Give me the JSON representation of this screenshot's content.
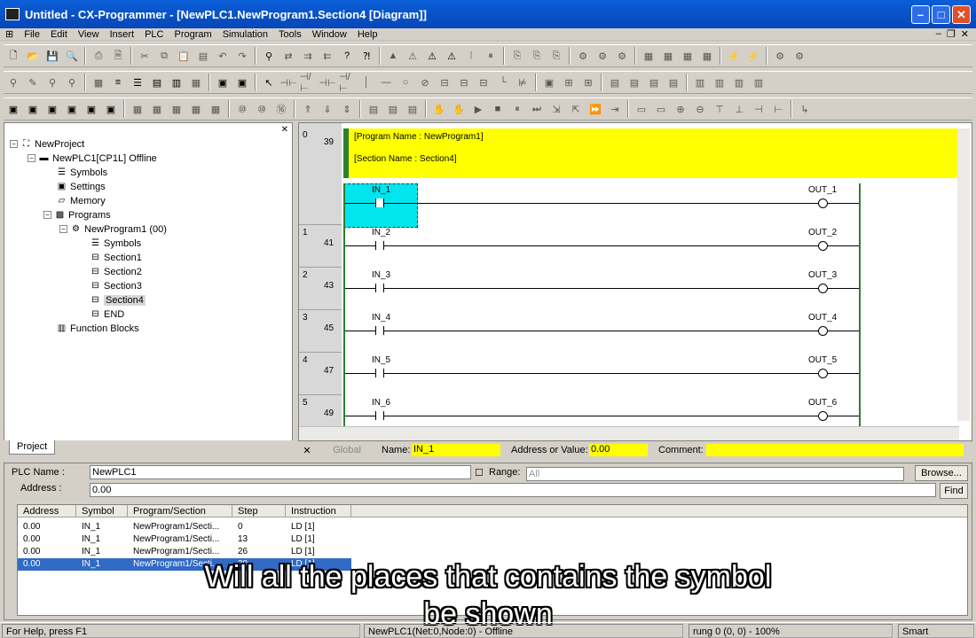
{
  "window": {
    "title": "Untitled - CX-Programmer - [NewPLC1.NewProgram1.Section4 [Diagram]]",
    "logo_text": "OMRON"
  },
  "menu": [
    "File",
    "Edit",
    "View",
    "Insert",
    "PLC",
    "Program",
    "Simulation",
    "Tools",
    "Window",
    "Help"
  ],
  "tree": {
    "root": "NewProject",
    "plc": "NewPLC1[CP1L] Offline",
    "symbols": "Symbols",
    "settings": "Settings",
    "memory": "Memory",
    "programs": "Programs",
    "program": "NewProgram1 (00)",
    "prog_symbols": "Symbols",
    "sections": [
      "Section1",
      "Section2",
      "Section3",
      "Section4",
      "END"
    ],
    "function_blocks": "Function Blocks"
  },
  "project_tab": "Project",
  "diagram": {
    "header_line1": "[Program Name : NewProgram1]",
    "header_line2": "[Section Name : Section4]",
    "rungs": [
      {
        "rung": "0",
        "step": "39",
        "contact": "IN_1",
        "coil": "OUT_1"
      },
      {
        "rung": "1",
        "step": "41",
        "contact": "IN_2",
        "coil": "OUT_2"
      },
      {
        "rung": "2",
        "step": "43",
        "contact": "IN_3",
        "coil": "OUT_3"
      },
      {
        "rung": "3",
        "step": "45",
        "contact": "IN_4",
        "coil": "OUT_4"
      },
      {
        "rung": "4",
        "step": "47",
        "contact": "IN_5",
        "coil": "OUT_5"
      },
      {
        "rung": "5",
        "step": "49",
        "contact": "IN_6",
        "coil": "OUT_6"
      }
    ]
  },
  "info_bar": {
    "global": "Global",
    "name_label": "Name:",
    "name_value": "IN_1",
    "address_label": "Address or Value:",
    "address_value": "0.00",
    "comment_label": "Comment:"
  },
  "find": {
    "plc_label": "PLC Name :",
    "plc_value": "NewPLC1",
    "range_label": "Range:",
    "range_value": "All",
    "browse": "Browse...",
    "address_label": "Address :",
    "address_value": "0.00",
    "find_button": "Find",
    "columns": [
      "Address",
      "Symbol",
      "Program/Section",
      "Step",
      "Instruction"
    ],
    "rows": [
      [
        "0.00",
        "IN_1",
        "NewProgram1/Secti...",
        "0",
        "LD [1]"
      ],
      [
        "0.00",
        "IN_1",
        "NewProgram1/Secti...",
        "13",
        "LD [1]"
      ],
      [
        "0.00",
        "IN_1",
        "NewProgram1/Secti...",
        "26",
        "LD [1]"
      ],
      [
        "0.00",
        "IN_1",
        "NewProgram1/Secti...",
        "39",
        "LD [1]"
      ]
    ]
  },
  "caption_line1": "Will all the places that contains the symbol",
  "caption_line2": "be shown",
  "status": {
    "help": "For Help, press F1",
    "plc": "NewPLC1(Net:0,Node:0) - Offline",
    "rung": "rung 0 (0, 0)  - 100%",
    "mode": "Smart"
  }
}
